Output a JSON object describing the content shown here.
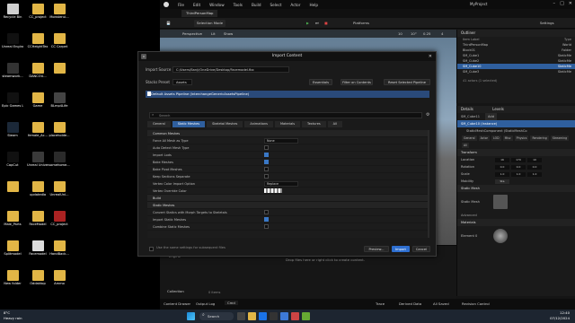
{
  "desktop": {
    "icons": [
      {
        "label": "Recycle Bin",
        "color": "#d0d0d0"
      },
      {
        "label": "CC_project",
        "color": "#e2b646"
      },
      {
        "label": "Monsterui...",
        "color": "#e2b646"
      },
      {
        "label": "Unreal Engine",
        "color": "#111111"
      },
      {
        "label": "CCHeightTex",
        "color": "#e2b646"
      },
      {
        "label": "CC Carpet",
        "color": "#e2b646"
      },
      {
        "label": "steamwork...",
        "color": "#333333"
      },
      {
        "label": "DANCOU...",
        "color": "#e2b646"
      },
      {
        "label": "",
        "color": "#e2b646"
      },
      {
        "label": "Epic Games Launcher",
        "color": "#111111"
      },
      {
        "label": "Game",
        "color": "#e2b646"
      },
      {
        "label": "BLmp4Life",
        "color": "#444444"
      },
      {
        "label": "Steam",
        "color": "#1b2838"
      },
      {
        "label": "female_Ac...",
        "color": "#e2b646"
      },
      {
        "label": "placeholde...",
        "color": "#e2b646"
      },
      {
        "label": "CapCut",
        "color": "#111111"
      },
      {
        "label": "Unreal Univers...",
        "color": "#3a3a3a"
      },
      {
        "label": "somehome...",
        "color": "#2a2a2a"
      },
      {
        "label": "",
        "color": "#e2b646"
      },
      {
        "label": "updatedla",
        "color": "#e2b646"
      },
      {
        "label": "UnrealUni...",
        "color": "#e2b646"
      },
      {
        "label": "Male_Parts",
        "color": "#e2b646"
      },
      {
        "label": "FaceModel",
        "color": "#e2b646"
      },
      {
        "label": "CC_project",
        "color": "#aa2222"
      },
      {
        "label": "Splitmodel",
        "color": "#e2b646"
      },
      {
        "label": "Facemodel",
        "color": "#dddddd"
      },
      {
        "label": "HandBack...",
        "color": "#e2b646"
      },
      {
        "label": "New folder",
        "color": "#e2b646"
      },
      {
        "label": "Oddaktop",
        "color": "#e2b646"
      },
      {
        "label": "Ammo",
        "color": "#e2b646"
      }
    ]
  },
  "ue": {
    "menu": [
      "File",
      "Edit",
      "Window",
      "Tools",
      "Build",
      "Select",
      "Actor",
      "Help"
    ],
    "project_name": "MyProject",
    "map_tab": "ThirdPersonMap",
    "toolbar": {
      "selection_mode": "Selection Mode",
      "platforms": "Platforms",
      "settings": "Settings"
    },
    "viewport": {
      "perspective": "Perspective",
      "lit": "Lit",
      "show": "Show",
      "grid_size": "10",
      "angle": "10°",
      "scale": "0.25",
      "camera_speed": "4"
    },
    "outliner": {
      "title": "Outliner",
      "column_label": "Item Label",
      "column_type": "Type",
      "rows": [
        {
          "label": "ThirdPersonMap",
          "type": "World",
          "selected": false
        },
        {
          "label": "Block01",
          "type": "Folder",
          "selected": false
        },
        {
          "label": "SM_Cube1",
          "type": "StaticMe",
          "selected": false
        },
        {
          "label": "SM_Cube2",
          "type": "StaticMe",
          "selected": false
        },
        {
          "label": "SM_Cube10",
          "type": "StaticMe",
          "selected": true
        },
        {
          "label": "SM_Cube3",
          "type": "StaticMe",
          "selected": false
        }
      ],
      "count": "41 actors (1 selected)"
    },
    "details": {
      "title": "Details",
      "levels_tab": "Levels",
      "actor_name": "SM_Cube11",
      "add_button": "Add",
      "instance": "SM_Cube10 (Instance)",
      "component": "StaticMeshComponent (StaticMeshCo",
      "filter_tabs": [
        "General",
        "Actor",
        "LOD",
        "Misc",
        "Physics",
        "Rendering",
        "Streaming",
        "All"
      ],
      "transform": "Transform",
      "location_label": "Location",
      "rotation_label": "Rotation",
      "scale_label": "Scale",
      "location": [
        "16",
        "170",
        "10"
      ],
      "rotation": [
        "0.0",
        "0.0",
        "0.0"
      ],
      "scale": [
        "1.0",
        "1.0",
        "1.0"
      ],
      "mobility_label": "Mobility",
      "mobility": "Sta",
      "static_mesh_section": "Static Mesh",
      "static_mesh_label": "Static Mesh",
      "advanced": "Advanced",
      "materials_section": "Materials",
      "element_label": "Element 0"
    },
    "content_browser": {
      "collection": "Collection",
      "items": "0 items",
      "drop_hint": "Drop files here or right click to create content.",
      "tree": [
        "ThirdPerson",
        "Engine"
      ]
    },
    "status": {
      "content_drawer": "Content Drawer",
      "output_log": "Output Log",
      "cmd": "Cmd",
      "trace": "Trace",
      "derived_data": "Derived Data",
      "all_saved": "All Saved",
      "revision_control": "Revision Control"
    }
  },
  "dialog": {
    "title": "Import Content",
    "import_source_label": "Import Source",
    "import_source_path": "C:/Users/Banji/OneDrive/Desktop/Facemodel.fbx",
    "stack_preset_label": "Stacks Preset",
    "stack_preset_value": "Assets",
    "essentials": "Essentials",
    "filter_on_contents": "Filter on Contents",
    "reset_selected_pipeline": "Reset Selected Pipeline",
    "pipeline": "Default Assets Pipeline (InterchangeGenericAssetsPipeline)",
    "search_placeholder": "Search",
    "tabs": [
      "General",
      "Static Meshes",
      "Skeletal Meshes",
      "Animations",
      "Materials",
      "Textures",
      "All"
    ],
    "active_tab": 1,
    "properties": [
      {
        "name": "Common Meshes",
        "section": true
      },
      {
        "name": "Force All Mesh as Type",
        "kind": "combo",
        "value": "None"
      },
      {
        "name": "Auto Detect Mesh Type",
        "kind": "check",
        "on": false
      },
      {
        "name": "Import Lods",
        "kind": "check",
        "on": true
      },
      {
        "name": "Bake Meshes",
        "kind": "check",
        "on": true
      },
      {
        "name": "Bake Pivot Meshes",
        "kind": "check",
        "on": false
      },
      {
        "name": "Keep Sections Separate",
        "kind": "check",
        "on": false
      },
      {
        "name": "Vertex Color Import Option",
        "kind": "combo",
        "value": "Replace"
      },
      {
        "name": "Vertex Override Color",
        "kind": "color"
      },
      {
        "name": "Build",
        "section": true
      },
      {
        "name": "Static Meshes",
        "section": true
      },
      {
        "name": "Convert Statics with Morph Targets to Skeletals",
        "kind": "check",
        "on": false
      },
      {
        "name": "Import Static Meshes",
        "kind": "check",
        "on": true
      },
      {
        "name": "Combine Static Meshes",
        "kind": "check",
        "on": false
      }
    ],
    "footer_text": "Use the same settings for subsequent files",
    "preview_button": "Preview...",
    "import_button": "Import",
    "cancel_button": "Cancel"
  },
  "taskbar": {
    "weather_temp": "8°C",
    "weather_desc": "Heavy rain",
    "search": "Search",
    "time": "12:40",
    "date": "07/12/2024"
  },
  "colors": {
    "accent_blue": "#2f5f9e",
    "import_button": "#2e6fd0",
    "desktop": "#000000"
  }
}
